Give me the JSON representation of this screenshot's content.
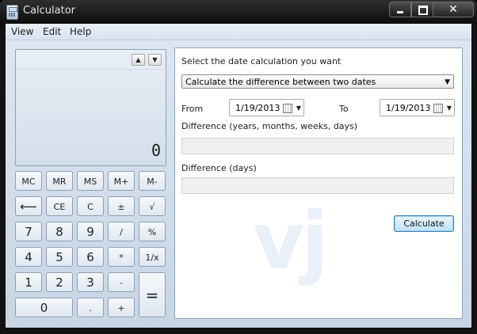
{
  "window": {
    "title": "Calculator"
  },
  "menu": {
    "view": "View",
    "edit": "Edit",
    "help": "Help"
  },
  "display": {
    "value": "0"
  },
  "keys": {
    "row1": [
      "MC",
      "MR",
      "MS",
      "M+",
      "M-"
    ],
    "row2": [
      "⟵",
      "CE",
      "C",
      "±",
      "√"
    ],
    "row3": [
      "7",
      "8",
      "9",
      "/",
      "%"
    ],
    "row4": [
      "4",
      "5",
      "6",
      "*",
      "1/x"
    ],
    "row5": [
      "1",
      "2",
      "3",
      "-"
    ],
    "row6": [
      "0",
      ".",
      "+"
    ],
    "equals": "="
  },
  "date_panel": {
    "prompt": "Select the date calculation you want",
    "mode": "Calculate the difference between two dates",
    "from_label": "From",
    "from_value": "1/19/2013",
    "to_label": "To",
    "to_value": "1/19/2013",
    "diff_ymwd_label": "Difference (years, months, weeks, days)",
    "diff_days_label": "Difference (days)",
    "calculate_label": "Calculate",
    "watermark": "vj"
  }
}
